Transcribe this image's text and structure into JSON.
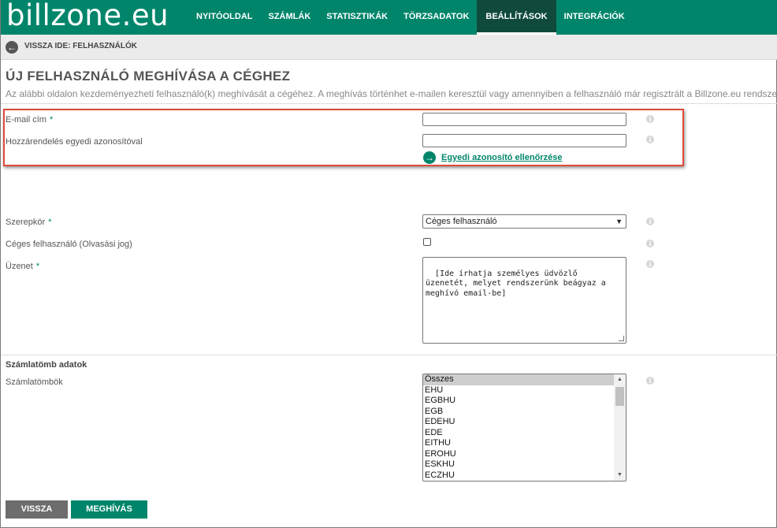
{
  "header": {
    "logo": "billzone.eu",
    "nav": [
      {
        "label": "NYITÓOLDAL"
      },
      {
        "label": "SZÁMLÁK"
      },
      {
        "label": "STATISZTIKÁK"
      },
      {
        "label": "TÖRZSADATOK"
      },
      {
        "label": "BEÁLLÍTÁSOK",
        "active": true
      },
      {
        "label": "INTEGRÁCIÓK"
      }
    ]
  },
  "backbar": {
    "label": "VISSZA IDE: FELHASZNÁLÓK",
    "icon": "arrow-left-icon"
  },
  "page": {
    "title": "ÚJ FELHASZNÁLÓ MEGHÍVÁSA A CÉGHEZ",
    "description": "Az alábbi oldalon kezdeményezheti felhasználó(k) meghívását a cégéhez. A meghívás történhet e-mailen keresztül vagy amennyiben a felhasználó már regisztrált a Billzone.eu rendszerben,"
  },
  "form": {
    "email": {
      "label": "E-mail cím",
      "required": "*",
      "value": ""
    },
    "identifier": {
      "label": "Hozzárendelés egyedi azonosítóval",
      "value": ""
    },
    "check_link": "Egyedi azonosító ellenőrzése",
    "role": {
      "label": "Szerepkör",
      "required": "*",
      "selected": "Céges felhasználó"
    },
    "readonly_user": {
      "label": "Céges felhasználó (Olvasási jog)",
      "checked": false
    },
    "message": {
      "label": "Üzenet",
      "required": "*",
      "value": "[Ide írhatja személyes üdvözlő üzenetét, melyet rendszerünk beágyaz a meghívó email-be]"
    },
    "invoice_section_title": "Számlatömb adatok",
    "invoice_blocks": {
      "label": "Számlatömbök",
      "options": [
        "Összes",
        "EHU",
        "EGBHU",
        "EGB",
        "EDEHU",
        "EDE",
        "EITHU",
        "EROHU",
        "ESKHU",
        "ECZHU"
      ],
      "selected": "Összes"
    }
  },
  "info_glyph": "i",
  "buttons": {
    "back": "VISSZA",
    "invite": "MEGHÍVÁS"
  },
  "colors": {
    "brand": "#00856b",
    "nav_active": "#0f4a3d",
    "highlight": "#e04a3a"
  }
}
